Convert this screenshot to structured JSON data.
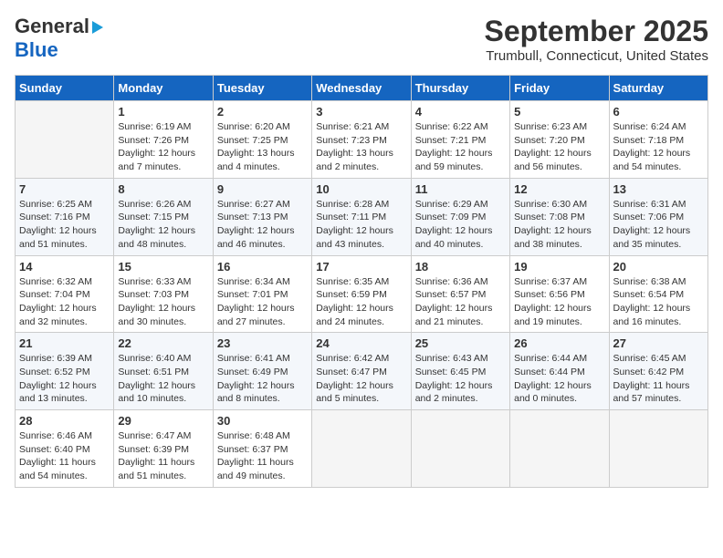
{
  "logo": {
    "part1": "General",
    "part2": "Blue"
  },
  "title": "September 2025",
  "subtitle": "Trumbull, Connecticut, United States",
  "weekdays": [
    "Sunday",
    "Monday",
    "Tuesday",
    "Wednesday",
    "Thursday",
    "Friday",
    "Saturday"
  ],
  "weeks": [
    [
      {
        "day": "",
        "empty": true
      },
      {
        "day": "1",
        "sunrise": "Sunrise: 6:19 AM",
        "sunset": "Sunset: 7:26 PM",
        "daylight": "Daylight: 12 hours and 7 minutes."
      },
      {
        "day": "2",
        "sunrise": "Sunrise: 6:20 AM",
        "sunset": "Sunset: 7:25 PM",
        "daylight": "Daylight: 13 hours and 4 minutes."
      },
      {
        "day": "3",
        "sunrise": "Sunrise: 6:21 AM",
        "sunset": "Sunset: 7:23 PM",
        "daylight": "Daylight: 13 hours and 2 minutes."
      },
      {
        "day": "4",
        "sunrise": "Sunrise: 6:22 AM",
        "sunset": "Sunset: 7:21 PM",
        "daylight": "Daylight: 12 hours and 59 minutes."
      },
      {
        "day": "5",
        "sunrise": "Sunrise: 6:23 AM",
        "sunset": "Sunset: 7:20 PM",
        "daylight": "Daylight: 12 hours and 56 minutes."
      },
      {
        "day": "6",
        "sunrise": "Sunrise: 6:24 AM",
        "sunset": "Sunset: 7:18 PM",
        "daylight": "Daylight: 12 hours and 54 minutes."
      }
    ],
    [
      {
        "day": "7",
        "sunrise": "Sunrise: 6:25 AM",
        "sunset": "Sunset: 7:16 PM",
        "daylight": "Daylight: 12 hours and 51 minutes."
      },
      {
        "day": "8",
        "sunrise": "Sunrise: 6:26 AM",
        "sunset": "Sunset: 7:15 PM",
        "daylight": "Daylight: 12 hours and 48 minutes."
      },
      {
        "day": "9",
        "sunrise": "Sunrise: 6:27 AM",
        "sunset": "Sunset: 7:13 PM",
        "daylight": "Daylight: 12 hours and 46 minutes."
      },
      {
        "day": "10",
        "sunrise": "Sunrise: 6:28 AM",
        "sunset": "Sunset: 7:11 PM",
        "daylight": "Daylight: 12 hours and 43 minutes."
      },
      {
        "day": "11",
        "sunrise": "Sunrise: 6:29 AM",
        "sunset": "Sunset: 7:09 PM",
        "daylight": "Daylight: 12 hours and 40 minutes."
      },
      {
        "day": "12",
        "sunrise": "Sunrise: 6:30 AM",
        "sunset": "Sunset: 7:08 PM",
        "daylight": "Daylight: 12 hours and 38 minutes."
      },
      {
        "day": "13",
        "sunrise": "Sunrise: 6:31 AM",
        "sunset": "Sunset: 7:06 PM",
        "daylight": "Daylight: 12 hours and 35 minutes."
      }
    ],
    [
      {
        "day": "14",
        "sunrise": "Sunrise: 6:32 AM",
        "sunset": "Sunset: 7:04 PM",
        "daylight": "Daylight: 12 hours and 32 minutes."
      },
      {
        "day": "15",
        "sunrise": "Sunrise: 6:33 AM",
        "sunset": "Sunset: 7:03 PM",
        "daylight": "Daylight: 12 hours and 30 minutes."
      },
      {
        "day": "16",
        "sunrise": "Sunrise: 6:34 AM",
        "sunset": "Sunset: 7:01 PM",
        "daylight": "Daylight: 12 hours and 27 minutes."
      },
      {
        "day": "17",
        "sunrise": "Sunrise: 6:35 AM",
        "sunset": "Sunset: 6:59 PM",
        "daylight": "Daylight: 12 hours and 24 minutes."
      },
      {
        "day": "18",
        "sunrise": "Sunrise: 6:36 AM",
        "sunset": "Sunset: 6:57 PM",
        "daylight": "Daylight: 12 hours and 21 minutes."
      },
      {
        "day": "19",
        "sunrise": "Sunrise: 6:37 AM",
        "sunset": "Sunset: 6:56 PM",
        "daylight": "Daylight: 12 hours and 19 minutes."
      },
      {
        "day": "20",
        "sunrise": "Sunrise: 6:38 AM",
        "sunset": "Sunset: 6:54 PM",
        "daylight": "Daylight: 12 hours and 16 minutes."
      }
    ],
    [
      {
        "day": "21",
        "sunrise": "Sunrise: 6:39 AM",
        "sunset": "Sunset: 6:52 PM",
        "daylight": "Daylight: 12 hours and 13 minutes."
      },
      {
        "day": "22",
        "sunrise": "Sunrise: 6:40 AM",
        "sunset": "Sunset: 6:51 PM",
        "daylight": "Daylight: 12 hours and 10 minutes."
      },
      {
        "day": "23",
        "sunrise": "Sunrise: 6:41 AM",
        "sunset": "Sunset: 6:49 PM",
        "daylight": "Daylight: 12 hours and 8 minutes."
      },
      {
        "day": "24",
        "sunrise": "Sunrise: 6:42 AM",
        "sunset": "Sunset: 6:47 PM",
        "daylight": "Daylight: 12 hours and 5 minutes."
      },
      {
        "day": "25",
        "sunrise": "Sunrise: 6:43 AM",
        "sunset": "Sunset: 6:45 PM",
        "daylight": "Daylight: 12 hours and 2 minutes."
      },
      {
        "day": "26",
        "sunrise": "Sunrise: 6:44 AM",
        "sunset": "Sunset: 6:44 PM",
        "daylight": "Daylight: 12 hours and 0 minutes."
      },
      {
        "day": "27",
        "sunrise": "Sunrise: 6:45 AM",
        "sunset": "Sunset: 6:42 PM",
        "daylight": "Daylight: 11 hours and 57 minutes."
      }
    ],
    [
      {
        "day": "28",
        "sunrise": "Sunrise: 6:46 AM",
        "sunset": "Sunset: 6:40 PM",
        "daylight": "Daylight: 11 hours and 54 minutes."
      },
      {
        "day": "29",
        "sunrise": "Sunrise: 6:47 AM",
        "sunset": "Sunset: 6:39 PM",
        "daylight": "Daylight: 11 hours and 51 minutes."
      },
      {
        "day": "30",
        "sunrise": "Sunrise: 6:48 AM",
        "sunset": "Sunset: 6:37 PM",
        "daylight": "Daylight: 11 hours and 49 minutes."
      },
      {
        "day": "",
        "empty": true
      },
      {
        "day": "",
        "empty": true
      },
      {
        "day": "",
        "empty": true
      },
      {
        "day": "",
        "empty": true
      }
    ]
  ]
}
